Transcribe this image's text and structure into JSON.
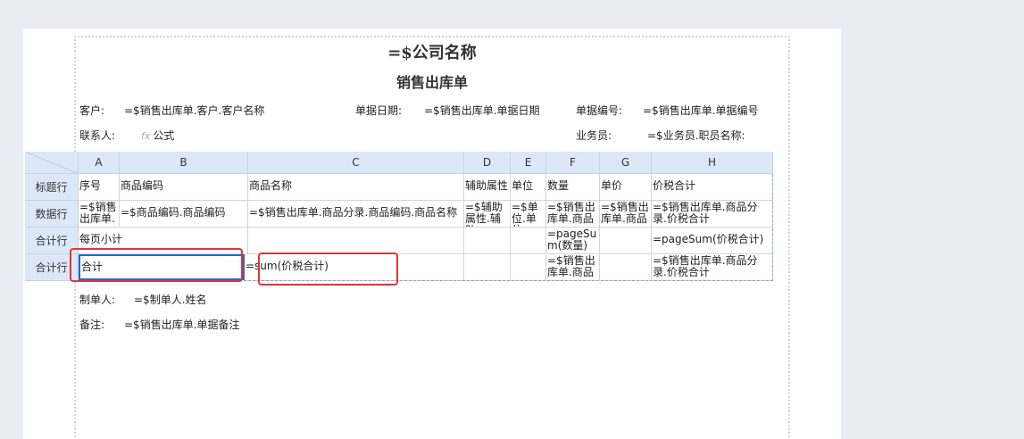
{
  "report": {
    "company_title": "=$公司名称",
    "doc_title": "销售出库单",
    "fields": {
      "customer_label": "客户:",
      "customer_value": "=$销售出库单.客户.客户名称",
      "date_label": "单据日期:",
      "date_value": "=$销售出库单.单据日期",
      "number_label": "单据编号:",
      "number_value": "=$销售出库单.单据编号",
      "contact_label": "联系人:",
      "contact_fx": "fx",
      "contact_value": "公式",
      "salesman_label": "业务员:",
      "salesman_value": "=$业务员.职员名称:",
      "maker_label": "制单人:",
      "maker_value": "=$制单人.姓名",
      "remark_label": "备注:",
      "remark_value": "=$销售出库单.单据备注"
    }
  },
  "grid": {
    "columns": [
      "A",
      "B",
      "C",
      "D",
      "E",
      "F",
      "G",
      "H"
    ],
    "row_labels": [
      "标题行",
      "数据行",
      "合计行",
      "合计行"
    ],
    "rows": [
      [
        "序号",
        "商品编码",
        "商品名称",
        "辅助属性",
        "单位",
        "数量",
        "单价",
        "价税合计"
      ],
      [
        "=$销售出库单.",
        "=$商品编码.商品编码",
        "=$销售出库单.商品分录.商品编码.商品名称",
        "=$辅助属性.辅助",
        "=$单位.单位",
        "=$销售出库单.商品",
        "=$销售出库单.商品",
        "=$销售出库单.商品分录.价税合计"
      ],
      [
        "每页小计",
        "",
        "",
        "",
        "",
        "=pageSum(数量)",
        "",
        "=pageSum(价税合计)"
      ],
      [
        "合计",
        "",
        "=sum(价税合计)",
        "",
        "",
        "=$销售出库单.商品",
        "",
        "=$销售出库单.商品分录.价税合计"
      ]
    ]
  }
}
